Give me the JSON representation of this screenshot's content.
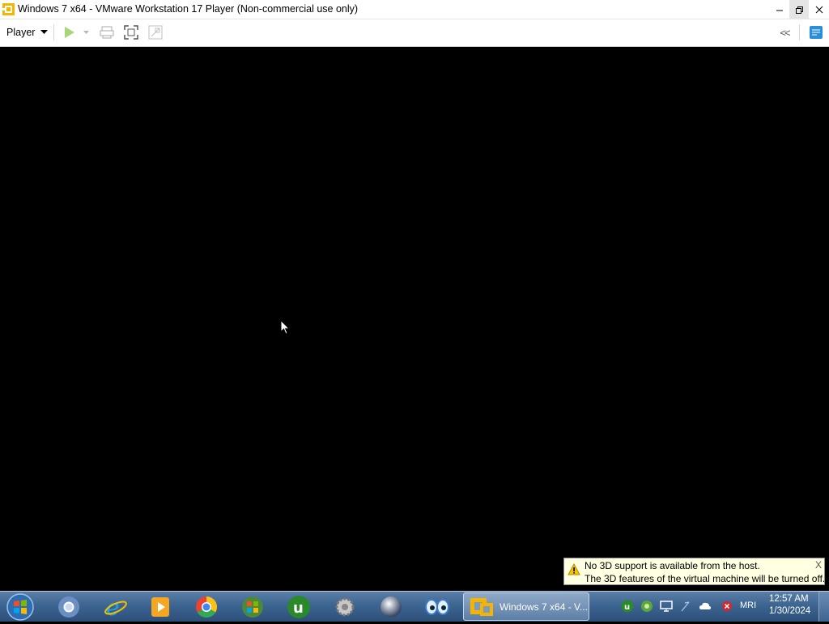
{
  "window": {
    "title": "Windows 7 x64 - VMware Workstation 17 Player (Non-commercial use only)",
    "icon": "vmware-icon"
  },
  "toolbar": {
    "player_label": "Player",
    "icons": [
      "play-icon",
      "dropdown-icon",
      "send-ctrl-alt-del-icon",
      "fullscreen-icon",
      "unity-icon",
      "collapse-icon",
      "notes-icon"
    ]
  },
  "notification": {
    "line1": "No 3D support is available from the host.",
    "line2": "The 3D features of the virtual machine will be turned off.",
    "close": "X"
  },
  "taskbar": {
    "pinned": [
      "start-orb-icon",
      "chromium-icon",
      "internet-explorer-icon",
      "media-player-icon",
      "chrome-icon",
      "windows-update-icon",
      "utorrent-icon",
      "settings-gear-icon",
      "sphere-icon",
      "eyes-icon"
    ],
    "active_task": "Windows 7 x64 - V...",
    "tray": [
      "utorrent-tray-icon",
      "network-tray-icon",
      "display-tray-icon",
      "signal-tray-icon",
      "cloud-tray-icon",
      "error-tray-icon"
    ],
    "language": "MRI",
    "time": "12:57 AM",
    "date": "1/30/2024"
  },
  "colors": {
    "taskbar": "#3d6591",
    "notification_bg": "#ffffe1",
    "vm_screen": "#000000",
    "play_green": "#7fc241"
  }
}
